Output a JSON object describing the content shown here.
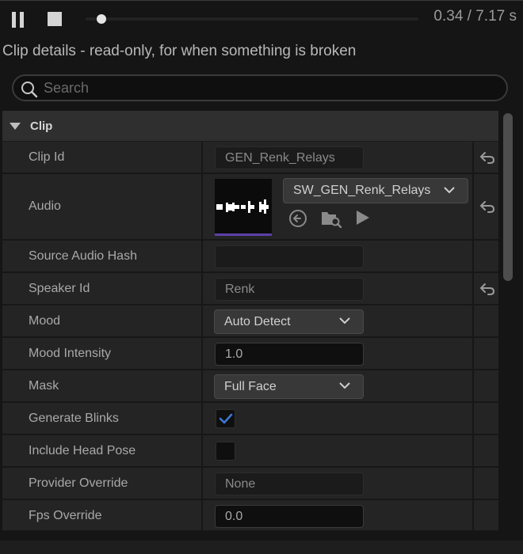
{
  "player": {
    "time_readout": "0.34 / 7.17 s",
    "progress_fraction": 0.047
  },
  "subtitle": "Clip details - read-only, for when something is broken",
  "search": {
    "placeholder": "Search",
    "value": ""
  },
  "section": {
    "title": "Clip"
  },
  "properties": {
    "clip_id": {
      "label": "Clip Id",
      "value": "GEN_Renk_Relays"
    },
    "audio": {
      "label": "Audio",
      "asset": "SW_GEN_Renk_Relays"
    },
    "source_audio_hash": {
      "label": "Source Audio Hash",
      "value": ""
    },
    "speaker_id": {
      "label": "Speaker Id",
      "value": "Renk"
    },
    "mood": {
      "label": "Mood",
      "value": "Auto Detect"
    },
    "mood_intensity": {
      "label": "Mood Intensity",
      "value": "1.0"
    },
    "mask": {
      "label": "Mask",
      "value": "Full Face"
    },
    "generate_blinks": {
      "label": "Generate Blinks",
      "checked": true
    },
    "include_head_pose": {
      "label": "Include Head Pose",
      "checked": false
    },
    "provider_override": {
      "label": "Provider Override",
      "value": "None"
    },
    "fps_override": {
      "label": "Fps Override",
      "value": "0.0"
    }
  },
  "icons": {
    "pause": "pause-icon",
    "stop": "stop-icon",
    "search": "search-icon",
    "reset": "reset-arrow-icon",
    "browse": "use-selected-asset-icon",
    "find": "browse-to-asset-icon",
    "play": "play-icon"
  },
  "colors": {
    "accent_check": "#3a78d6",
    "thumbnail_underline": "#5c3fa8"
  }
}
